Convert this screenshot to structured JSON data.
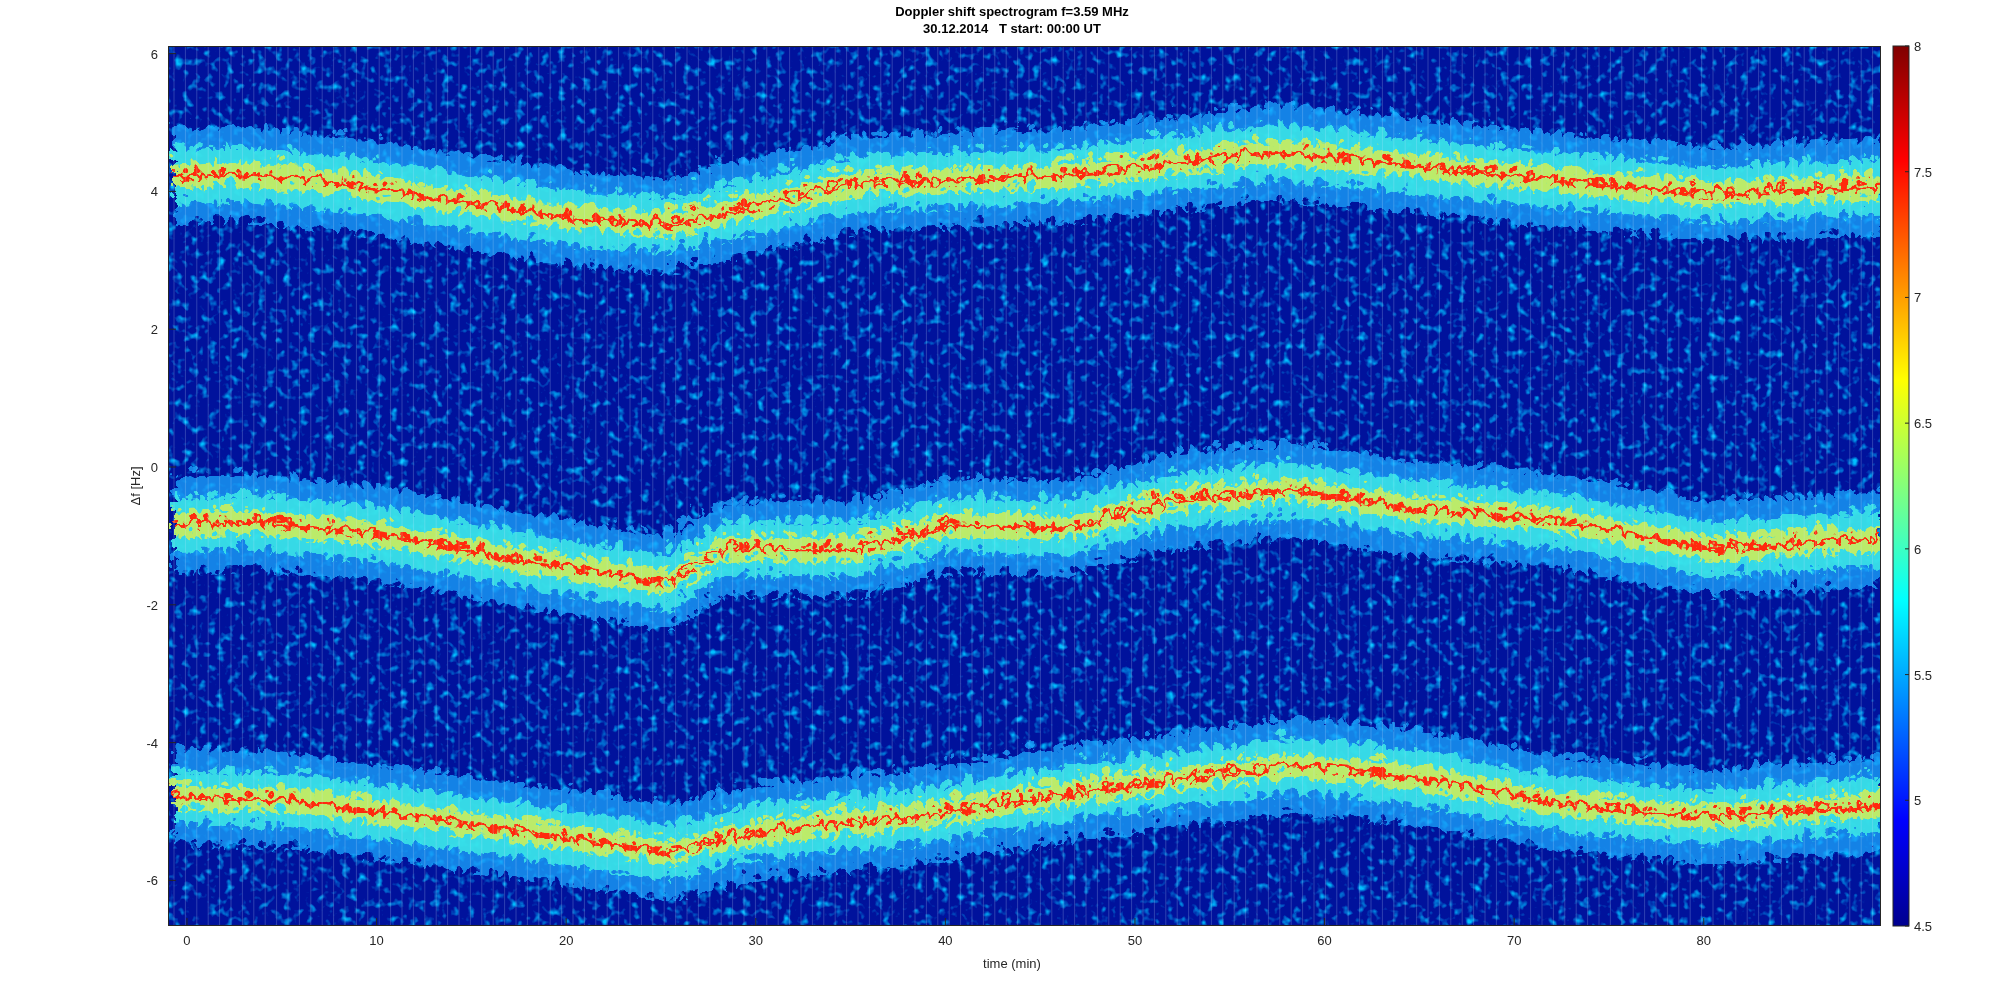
{
  "plot": {
    "title": [
      "Doppler shift spectrogram f=3.59 MHz",
      "30.12.2014   T start: 00:00 UT"
    ],
    "xlabel": "time (min)",
    "ylabel": "Δf [Hz]",
    "xticks": [
      "0",
      "10",
      "20",
      "30",
      "40",
      "50",
      "60",
      "70",
      "80"
    ],
    "yticks": [
      "6",
      "4",
      "2",
      "0",
      "-2",
      "-4",
      "-6"
    ],
    "colorbar": {
      "ticks": [
        "8",
        "7.5",
        "7",
        "6.5",
        "6",
        "5.5",
        "5",
        "4.5"
      ]
    }
  }
}
